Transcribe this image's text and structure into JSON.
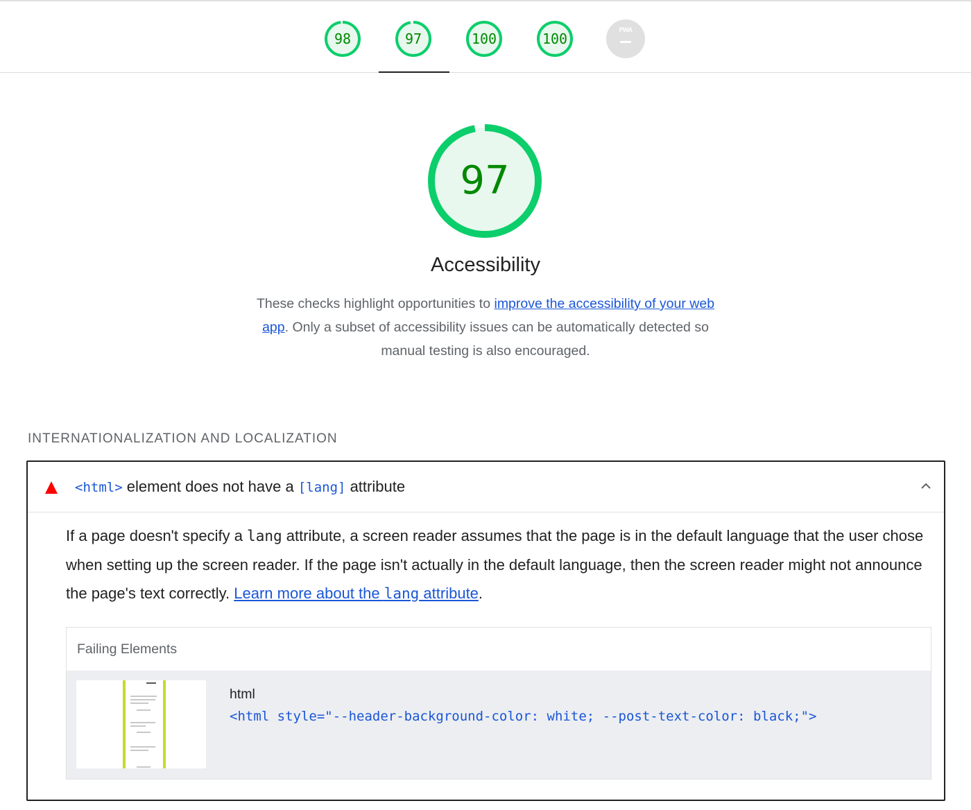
{
  "tabs": [
    {
      "score": "98",
      "color": "#0cce6b",
      "fraction": 0.98
    },
    {
      "score": "97",
      "color": "#0cce6b",
      "fraction": 0.97,
      "active": true
    },
    {
      "score": "100",
      "color": "#0cce6b",
      "fraction": 1.0
    },
    {
      "score": "100",
      "color": "#0cce6b",
      "fraction": 1.0
    },
    {
      "badge": "PWA",
      "value": "—"
    }
  ],
  "category": {
    "score": "97",
    "fraction": 0.97,
    "title": "Accessibility",
    "desc_before": "These checks highlight opportunities to ",
    "desc_link": "improve the accessibility of your web app",
    "desc_after": ". Only a subset of accessibility issues can be automatically detected so manual testing is also encouraged."
  },
  "group": {
    "title": "INTERNATIONALIZATION AND LOCALIZATION"
  },
  "audit": {
    "title_code1": "<html>",
    "title_text1": " element does not have a ",
    "title_code2": "[lang]",
    "title_text2": " attribute",
    "desc_1": "If a page doesn't specify a ",
    "desc_code": "lang",
    "desc_2": " attribute, a screen reader assumes that the page is in the default language that the user chose when setting up the screen reader. If the page isn't actually in the default language, then the screen reader might not announce the page's text correctly. ",
    "link_1": "Learn more about the ",
    "link_code": "lang",
    "link_2": " attribute",
    "desc_end": ".",
    "details_header": "Failing Elements",
    "node_label": "html",
    "node_snippet": "<html style=\"--header-background-color: white; --post-text-color: black;\">"
  },
  "colors": {
    "pass": "#0cce6b",
    "pass_text": "#008800",
    "fail": "#ff0000",
    "link": "#1a56d6"
  }
}
